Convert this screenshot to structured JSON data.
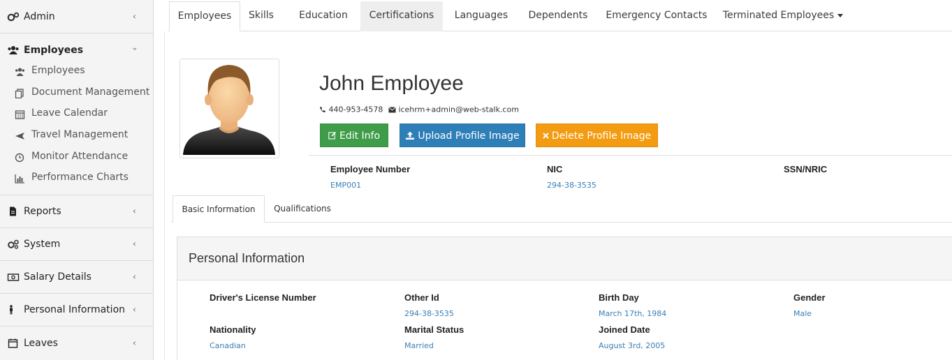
{
  "sidebar": {
    "admin": {
      "label": "Admin",
      "icon": "cogs-icon"
    },
    "employees": {
      "label": "Employees",
      "icon": "users-icon"
    },
    "employee_items": [
      {
        "label": "Employees",
        "icon": "users-icon"
      },
      {
        "label": "Document Management",
        "icon": "documents-icon"
      },
      {
        "label": "Leave Calendar",
        "icon": "calendar-icon"
      },
      {
        "label": "Travel Management",
        "icon": "plane-icon"
      },
      {
        "label": "Monitor Attendance",
        "icon": "clock-icon"
      },
      {
        "label": "Performance Charts",
        "icon": "bar-chart-icon"
      }
    ],
    "sections": [
      {
        "label": "Reports",
        "icon": "file-icon"
      },
      {
        "label": "System",
        "icon": "cogs-icon"
      },
      {
        "label": "Salary Details",
        "icon": "money-icon"
      },
      {
        "label": "Personal Information",
        "icon": "person-icon"
      },
      {
        "label": "Leaves",
        "icon": "calendar-icon"
      }
    ]
  },
  "tabs": [
    "Employees",
    "Skills",
    "Education",
    "Certifications",
    "Languages",
    "Dependents",
    "Emergency Contacts",
    "Terminated Employees"
  ],
  "profile": {
    "name": "John Employee",
    "phone": "440-953-4578",
    "email": "icehrm+admin@web-stalk.com",
    "buttons": {
      "edit": "Edit Info",
      "upload": "Upload Profile Image",
      "delete": "Delete Profile Image"
    },
    "fields": [
      {
        "label": "Employee Number",
        "value": "EMP001"
      },
      {
        "label": "NIC",
        "value": "294-38-3535"
      },
      {
        "label": "SSN/NRIC",
        "value": ""
      }
    ]
  },
  "subtabs": [
    "Basic Information",
    "Qualifications"
  ],
  "personal": {
    "title": "Personal Information",
    "fields": [
      {
        "label": "Driver's License Number",
        "value": ""
      },
      {
        "label": "Other Id",
        "value": "294-38-3535"
      },
      {
        "label": "Birth Day",
        "value": "March 17th, 1984"
      },
      {
        "label": "Gender",
        "value": "Male"
      },
      {
        "label": "Nationality",
        "value": "Canadian"
      },
      {
        "label": "Marital Status",
        "value": "Married"
      },
      {
        "label": "Joined Date",
        "value": "August 3rd, 2005"
      }
    ]
  },
  "colors": {
    "edit_button": "#3f9c48",
    "upload_button": "#2e7fb7",
    "delete_button": "#f39c12",
    "link_value": "#3a7fb5"
  }
}
